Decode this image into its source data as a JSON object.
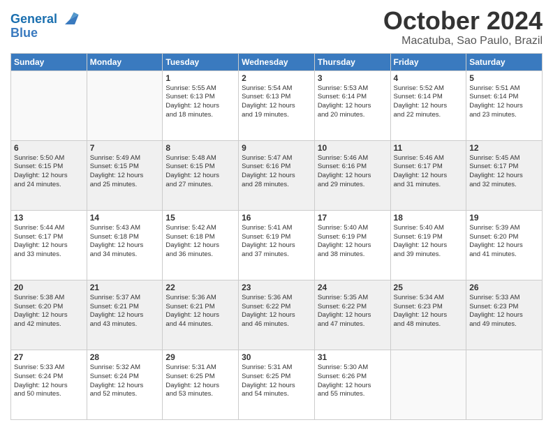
{
  "header": {
    "logo_line1": "General",
    "logo_line2": "Blue",
    "month": "October 2024",
    "location": "Macatuba, Sao Paulo, Brazil"
  },
  "weekdays": [
    "Sunday",
    "Monday",
    "Tuesday",
    "Wednesday",
    "Thursday",
    "Friday",
    "Saturday"
  ],
  "weeks": [
    [
      {
        "day": "",
        "info": ""
      },
      {
        "day": "",
        "info": ""
      },
      {
        "day": "1",
        "info": "Sunrise: 5:55 AM\nSunset: 6:13 PM\nDaylight: 12 hours\nand 18 minutes."
      },
      {
        "day": "2",
        "info": "Sunrise: 5:54 AM\nSunset: 6:13 PM\nDaylight: 12 hours\nand 19 minutes."
      },
      {
        "day": "3",
        "info": "Sunrise: 5:53 AM\nSunset: 6:14 PM\nDaylight: 12 hours\nand 20 minutes."
      },
      {
        "day": "4",
        "info": "Sunrise: 5:52 AM\nSunset: 6:14 PM\nDaylight: 12 hours\nand 22 minutes."
      },
      {
        "day": "5",
        "info": "Sunrise: 5:51 AM\nSunset: 6:14 PM\nDaylight: 12 hours\nand 23 minutes."
      }
    ],
    [
      {
        "day": "6",
        "info": "Sunrise: 5:50 AM\nSunset: 6:15 PM\nDaylight: 12 hours\nand 24 minutes."
      },
      {
        "day": "7",
        "info": "Sunrise: 5:49 AM\nSunset: 6:15 PM\nDaylight: 12 hours\nand 25 minutes."
      },
      {
        "day": "8",
        "info": "Sunrise: 5:48 AM\nSunset: 6:15 PM\nDaylight: 12 hours\nand 27 minutes."
      },
      {
        "day": "9",
        "info": "Sunrise: 5:47 AM\nSunset: 6:16 PM\nDaylight: 12 hours\nand 28 minutes."
      },
      {
        "day": "10",
        "info": "Sunrise: 5:46 AM\nSunset: 6:16 PM\nDaylight: 12 hours\nand 29 minutes."
      },
      {
        "day": "11",
        "info": "Sunrise: 5:46 AM\nSunset: 6:17 PM\nDaylight: 12 hours\nand 31 minutes."
      },
      {
        "day": "12",
        "info": "Sunrise: 5:45 AM\nSunset: 6:17 PM\nDaylight: 12 hours\nand 32 minutes."
      }
    ],
    [
      {
        "day": "13",
        "info": "Sunrise: 5:44 AM\nSunset: 6:17 PM\nDaylight: 12 hours\nand 33 minutes."
      },
      {
        "day": "14",
        "info": "Sunrise: 5:43 AM\nSunset: 6:18 PM\nDaylight: 12 hours\nand 34 minutes."
      },
      {
        "day": "15",
        "info": "Sunrise: 5:42 AM\nSunset: 6:18 PM\nDaylight: 12 hours\nand 36 minutes."
      },
      {
        "day": "16",
        "info": "Sunrise: 5:41 AM\nSunset: 6:19 PM\nDaylight: 12 hours\nand 37 minutes."
      },
      {
        "day": "17",
        "info": "Sunrise: 5:40 AM\nSunset: 6:19 PM\nDaylight: 12 hours\nand 38 minutes."
      },
      {
        "day": "18",
        "info": "Sunrise: 5:40 AM\nSunset: 6:19 PM\nDaylight: 12 hours\nand 39 minutes."
      },
      {
        "day": "19",
        "info": "Sunrise: 5:39 AM\nSunset: 6:20 PM\nDaylight: 12 hours\nand 41 minutes."
      }
    ],
    [
      {
        "day": "20",
        "info": "Sunrise: 5:38 AM\nSunset: 6:20 PM\nDaylight: 12 hours\nand 42 minutes."
      },
      {
        "day": "21",
        "info": "Sunrise: 5:37 AM\nSunset: 6:21 PM\nDaylight: 12 hours\nand 43 minutes."
      },
      {
        "day": "22",
        "info": "Sunrise: 5:36 AM\nSunset: 6:21 PM\nDaylight: 12 hours\nand 44 minutes."
      },
      {
        "day": "23",
        "info": "Sunrise: 5:36 AM\nSunset: 6:22 PM\nDaylight: 12 hours\nand 46 minutes."
      },
      {
        "day": "24",
        "info": "Sunrise: 5:35 AM\nSunset: 6:22 PM\nDaylight: 12 hours\nand 47 minutes."
      },
      {
        "day": "25",
        "info": "Sunrise: 5:34 AM\nSunset: 6:23 PM\nDaylight: 12 hours\nand 48 minutes."
      },
      {
        "day": "26",
        "info": "Sunrise: 5:33 AM\nSunset: 6:23 PM\nDaylight: 12 hours\nand 49 minutes."
      }
    ],
    [
      {
        "day": "27",
        "info": "Sunrise: 5:33 AM\nSunset: 6:24 PM\nDaylight: 12 hours\nand 50 minutes."
      },
      {
        "day": "28",
        "info": "Sunrise: 5:32 AM\nSunset: 6:24 PM\nDaylight: 12 hours\nand 52 minutes."
      },
      {
        "day": "29",
        "info": "Sunrise: 5:31 AM\nSunset: 6:25 PM\nDaylight: 12 hours\nand 53 minutes."
      },
      {
        "day": "30",
        "info": "Sunrise: 5:31 AM\nSunset: 6:25 PM\nDaylight: 12 hours\nand 54 minutes."
      },
      {
        "day": "31",
        "info": "Sunrise: 5:30 AM\nSunset: 6:26 PM\nDaylight: 12 hours\nand 55 minutes."
      },
      {
        "day": "",
        "info": ""
      },
      {
        "day": "",
        "info": ""
      }
    ]
  ]
}
